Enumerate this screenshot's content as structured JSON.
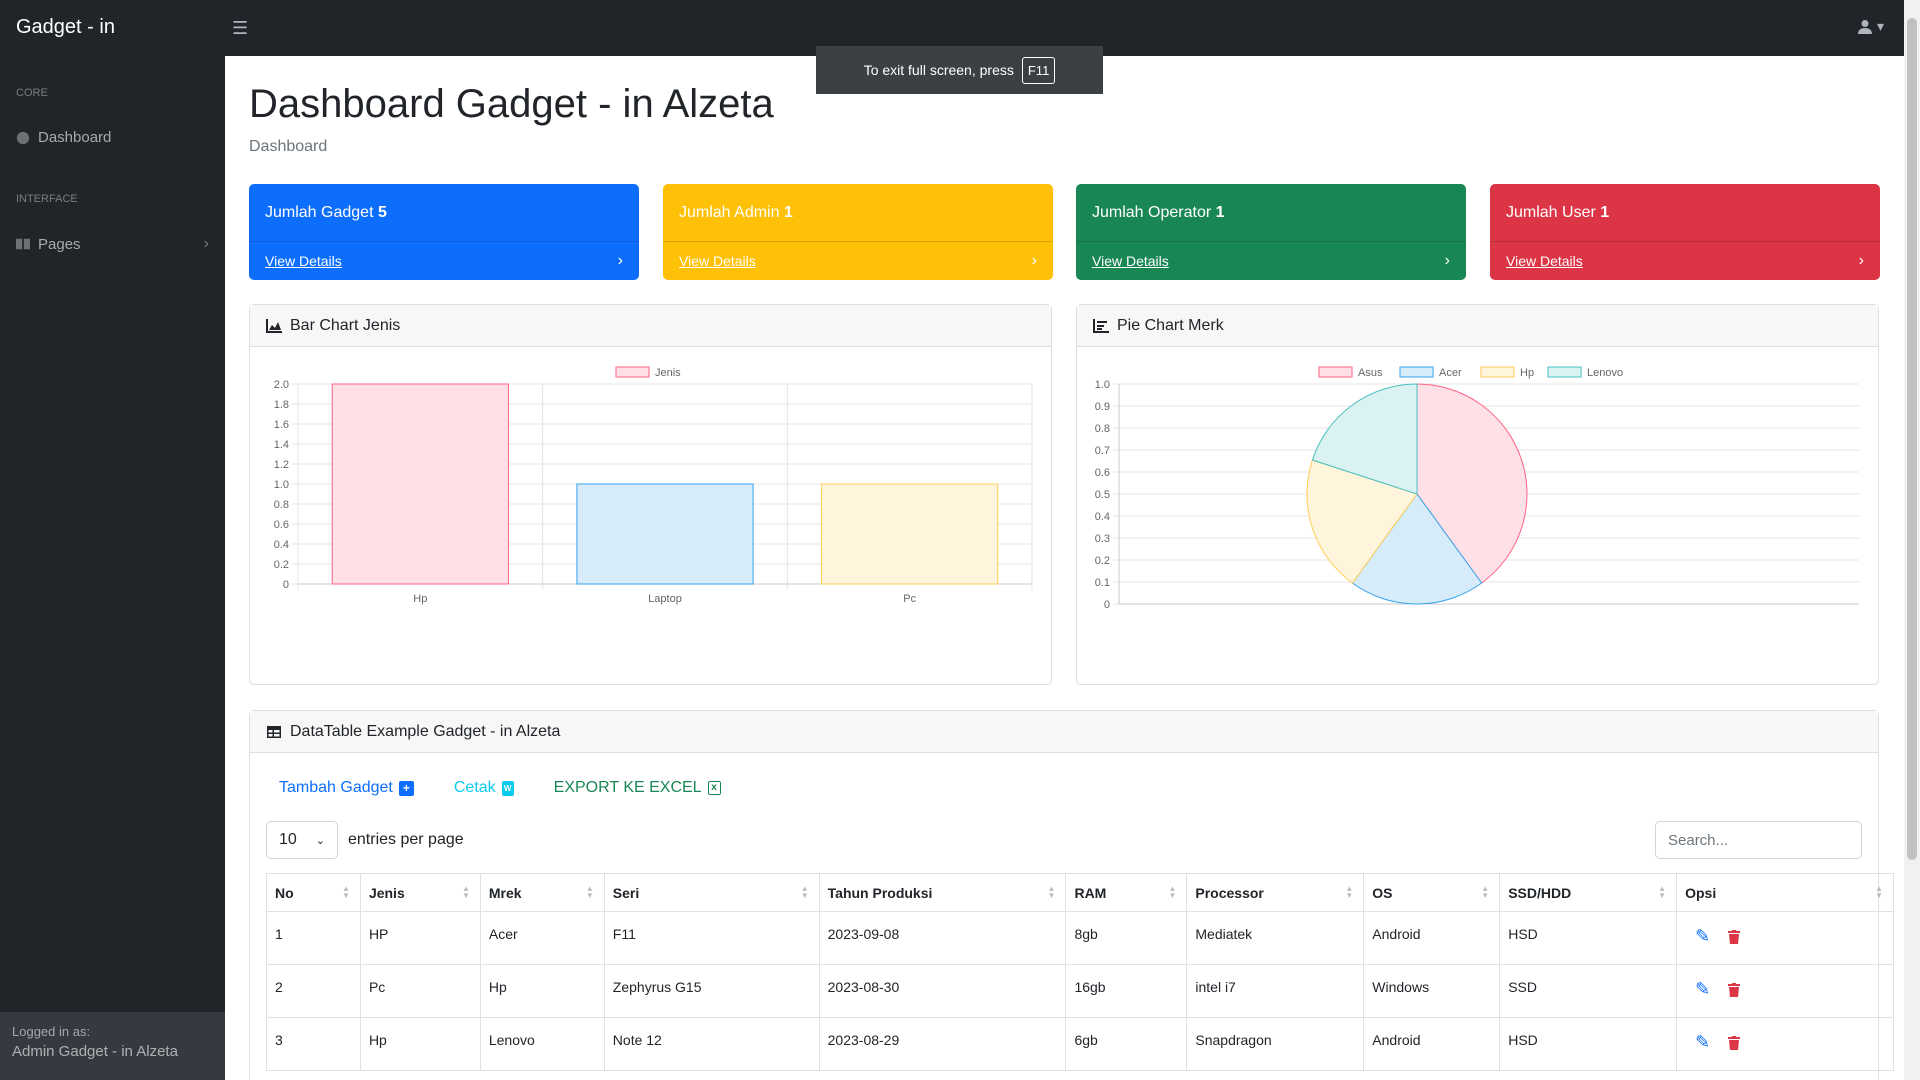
{
  "app": {
    "brand": "Gadget - in"
  },
  "topbar": {
    "menu_icon": "hamburger-icon",
    "user_icon": "user-icon"
  },
  "fullscreen": {
    "message": "To exit full screen, press",
    "key": "F11"
  },
  "sidebar": {
    "core_heading": "CORE",
    "dashboard_label": "Dashboard",
    "interface_heading": "INTERFACE",
    "pages_label": "Pages",
    "footer_small": "Logged in as:",
    "footer_user": "Admin Gadget - in Alzeta"
  },
  "page": {
    "title": "Dashboard Gadget - in Alzeta",
    "breadcrumb": "Dashboard"
  },
  "stats": [
    {
      "label": "Jumlah Gadget",
      "value": "5",
      "link": "View Details",
      "color": "#0d6efd"
    },
    {
      "label": "Jumlah Admin",
      "value": "1",
      "link": "View Details",
      "color": "#ffc107"
    },
    {
      "label": "Jumlah Operator",
      "value": "1",
      "link": "View Details",
      "color": "#198754"
    },
    {
      "label": "Jumlah User",
      "value": "1",
      "link": "View Details",
      "color": "#dc3545"
    }
  ],
  "bar_card": {
    "title": "Bar Chart Jenis"
  },
  "pie_card": {
    "title": "Pie Chart Merk"
  },
  "chart_data": [
    {
      "type": "bar",
      "categories": [
        "Hp",
        "Laptop",
        "Pc"
      ],
      "series": [
        {
          "name": "Jenis",
          "values": [
            2,
            1,
            1
          ]
        }
      ],
      "ylim": [
        0,
        2
      ],
      "yticks": [
        "0",
        "0.2",
        "0.4",
        "0.6",
        "0.8",
        "1.0",
        "1.2",
        "1.4",
        "1.6",
        "1.8",
        "2.0"
      ],
      "fills": [
        "#ffe0e6",
        "#d7ecfb",
        "#fff5dd"
      ],
      "strokes": [
        "#ff6384",
        "#36a2eb",
        "#ffce56"
      ],
      "legend": "top",
      "grid": true
    },
    {
      "type": "pie",
      "labels": [
        "Asus",
        "Acer",
        "Hp",
        "Lenovo"
      ],
      "values": [
        2,
        1,
        1,
        1
      ],
      "fills": [
        "#ffe0e6",
        "#d7ecfb",
        "#fff5dd",
        "#dbf2f2"
      ],
      "strokes": [
        "#ff6384",
        "#36a2eb",
        "#ffce56",
        "#4bc0c0"
      ],
      "yticks": [
        "0",
        "0.1",
        "0.2",
        "0.3",
        "0.4",
        "0.5",
        "0.6",
        "0.7",
        "0.8",
        "0.9",
        "1.0"
      ],
      "legend": "top",
      "grid": true
    }
  ],
  "table_card": {
    "title": "DataTable Example Gadget - in Alzeta",
    "add_label": "Tambah Gadget",
    "print_label": "Cetak",
    "excel_label": "EXPORT KE EXCEL",
    "entries_value": "10",
    "entries_label": "entries per page",
    "search_placeholder": "Search...",
    "columns": [
      "No",
      "Jenis",
      "Mrek",
      "Seri",
      "Tahun Produksi",
      "RAM",
      "Processor",
      "OS",
      "SSD/HDD",
      "Opsi"
    ],
    "rows": [
      [
        "1",
        "HP",
        "Acer",
        "F11",
        "2023-09-08",
        "8gb",
        "Mediatek",
        "Android",
        "HSD"
      ],
      [
        "2",
        "Pc",
        "Hp",
        "Zephyrus G15",
        "2023-08-30",
        "16gb",
        "intel i7",
        "Windows",
        "SSD"
      ],
      [
        "3",
        "Hp",
        "Lenovo",
        "Note 12",
        "2023-08-29",
        "6gb",
        "Snapdragon",
        "Android",
        "HSD"
      ]
    ]
  }
}
